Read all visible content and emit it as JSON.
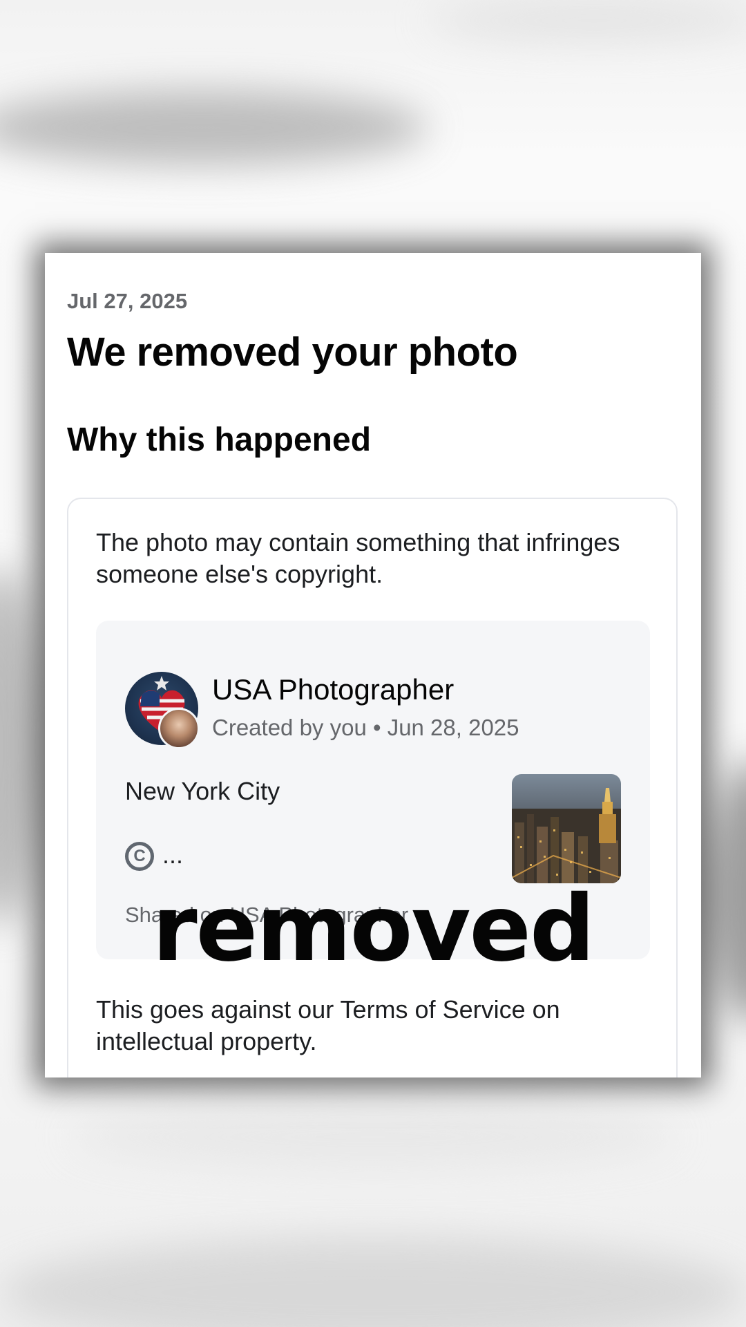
{
  "notice": {
    "date": "Jul 27, 2025",
    "title": "We removed your photo",
    "section_heading": "Why this happened",
    "reason": "The photo may contain something that infringes someone else's copyright.",
    "policy_text": "This goes against our Terms of Service on intellectual property."
  },
  "post": {
    "page_name": "USA Photographer",
    "meta": "Created by you • Jun 28, 2025",
    "text": "New York City",
    "copyright_symbol": "C",
    "copyright_ellipsis": "...",
    "shared_on": "Shared on USA Photographer"
  },
  "overlay": {
    "word": "removed"
  },
  "colors": {
    "primary_text": "#050505",
    "secondary_text": "#65676b",
    "preview_bg": "#f5f6f8",
    "border": "#e4e6eb"
  },
  "icons": {
    "avatar": "american-flag-heart-avatar",
    "badge": "profile-photo-badge",
    "copyright": "copyright-icon",
    "thumbnail": "city-skyline-thumbnail"
  }
}
